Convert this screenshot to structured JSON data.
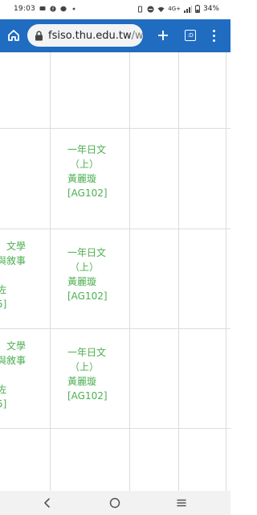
{
  "status_bar": {
    "time": "19:03",
    "battery": "34%",
    "network": "4G+"
  },
  "browser": {
    "url_domain": "fsiso.thu.edu.tw",
    "url_path": "/w",
    "tab_count": ":D"
  },
  "table": {
    "left_column_rows": [
      {
        "line1": "：文學",
        "line2": "與敘事",
        "line3": "佐",
        "line4": "5]"
      },
      {
        "line1": "：文學",
        "line2": "與敘事",
        "line3": "佐",
        "line4": "5]"
      }
    ],
    "course_cells": [
      {
        "name": "一年日文",
        "section": "（上）",
        "teacher": "黃麗璇",
        "room": "[AG102]"
      },
      {
        "name": "一年日文",
        "section": "（上）",
        "teacher": "黃麗璇",
        "room": "[AG102]"
      },
      {
        "name": "一年日文",
        "section": "（上）",
        "teacher": "黃麗璇",
        "room": "[AG102]"
      }
    ]
  },
  "colors": {
    "toolbar": "#1f6cc1",
    "course_text": "#4caf50",
    "grid_line": "#dcdcdc"
  }
}
